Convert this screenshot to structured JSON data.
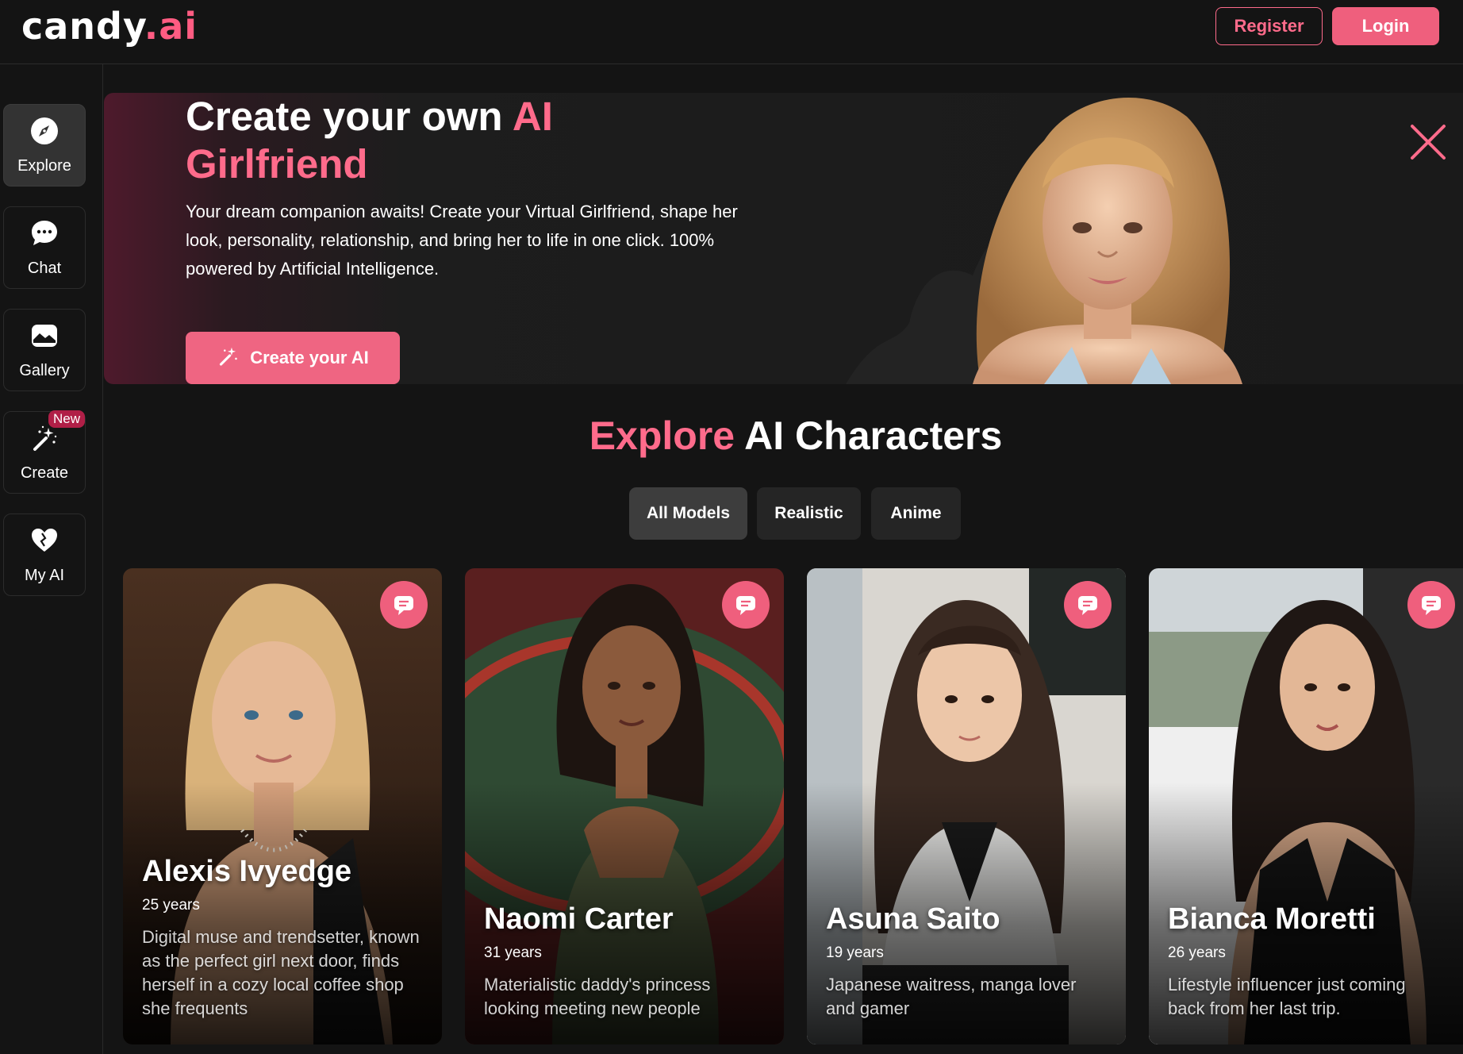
{
  "brand": {
    "logo_main": "candy",
    "logo_accent": ".ai",
    "accent_color": "#ff5c82"
  },
  "header": {
    "register_label": "Register",
    "login_label": "Login"
  },
  "sidebar": {
    "items": [
      {
        "label": "Explore",
        "icon": "compass-icon",
        "active": true
      },
      {
        "label": "Chat",
        "icon": "chat-bubble-icon",
        "active": false
      },
      {
        "label": "Gallery",
        "icon": "image-icon",
        "active": false
      },
      {
        "label": "Create",
        "icon": "magic-wand-icon",
        "active": false,
        "badge": "New"
      },
      {
        "label": "My AI",
        "icon": "heart-icon",
        "active": false
      }
    ]
  },
  "hero": {
    "title_white": "Create your own ",
    "title_pink_1": "AI",
    "title_pink_2": "Girlfriend",
    "description": "Your dream companion awaits! Create your Virtual Girlfriend, shape her look, personality, relationship, and bring her to life in one click. 100% powered by Artificial Intelligence.",
    "cta_label": "Create your AI",
    "close_icon": "close-icon"
  },
  "explore": {
    "title_pink": "Explore",
    "title_white": " AI Characters",
    "tabs": [
      {
        "label": "All Models",
        "active": true
      },
      {
        "label": "Realistic",
        "active": false
      },
      {
        "label": "Anime",
        "active": false
      }
    ]
  },
  "characters": [
    {
      "name": "Alexis Ivyedge",
      "age": "25 years",
      "description": "Digital muse and trendsetter, known as the perfect girl next door, finds herself in a cozy local coffee shop she frequents"
    },
    {
      "name": "Naomi Carter",
      "age": "31 years",
      "description": "Materialistic daddy's princess looking meeting new people"
    },
    {
      "name": "Asuna Saito",
      "age": "19 years",
      "description": "Japanese waitress, manga lover and gamer"
    },
    {
      "name": "Bianca Moretti",
      "age": "26 years",
      "description": "Lifestyle influencer just coming back from her last trip."
    }
  ]
}
